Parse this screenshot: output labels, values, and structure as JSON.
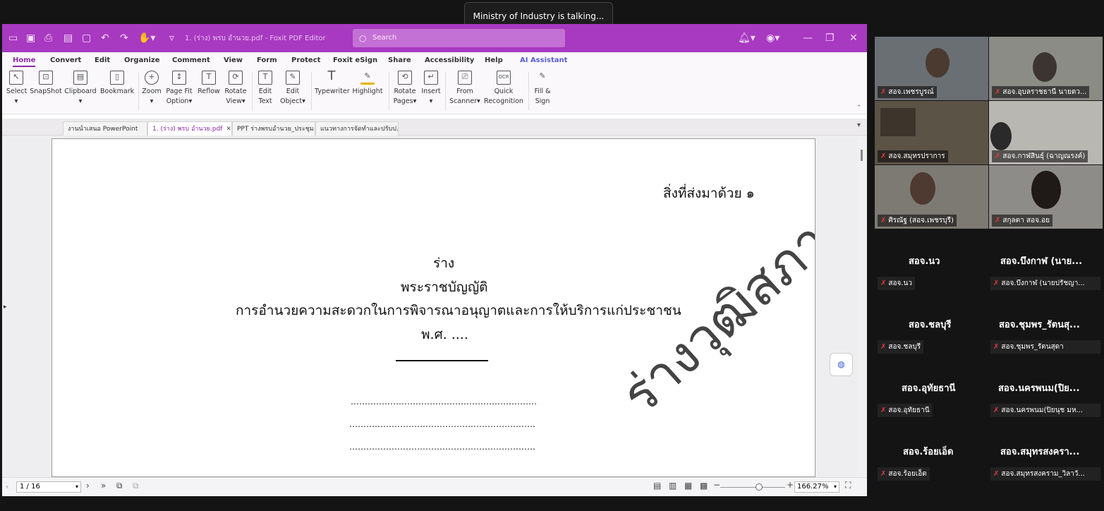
{
  "meeting": {
    "talking_banner": "Ministry of Industry is talking..."
  },
  "app": {
    "title": "1. (ร่าง) พรบ อำนวย.pdf - Foxit PDF Editor",
    "search_placeholder": "Search",
    "menu": [
      "Home",
      "Convert",
      "Edit",
      "Organize",
      "Comment",
      "View",
      "Form",
      "Protect",
      "Foxit eSign",
      "Share",
      "Accessibility",
      "Help",
      "AI Assistant"
    ],
    "ribbon": [
      {
        "l1": "Select",
        "l2": "",
        "icon": "select-icon"
      },
      {
        "l1": "SnapShot",
        "l2": "",
        "icon": "snapshot-icon"
      },
      {
        "l1": "Clipboard",
        "l2": "",
        "icon": "clipboard-icon"
      },
      {
        "l1": "Bookmark",
        "l2": "",
        "icon": "bookmark-icon"
      },
      {
        "l1": "Zoom",
        "l2": "",
        "icon": "zoom-icon"
      },
      {
        "l1": "Page Fit",
        "l2": "Option",
        "icon": "page-fit-icon"
      },
      {
        "l1": "Reflow",
        "l2": "",
        "icon": "reflow-icon"
      },
      {
        "l1": "Rotate",
        "l2": "View",
        "icon": "rotate-view-icon"
      },
      {
        "l1": "Edit",
        "l2": "Text",
        "icon": "edit-text-icon"
      },
      {
        "l1": "Edit",
        "l2": "Object",
        "icon": "edit-object-icon"
      },
      {
        "l1": "Typewriter",
        "l2": "",
        "icon": "typewriter-icon"
      },
      {
        "l1": "Highlight",
        "l2": "",
        "icon": "highlight-icon"
      },
      {
        "l1": "Rotate",
        "l2": "Pages",
        "icon": "rotate-pages-icon"
      },
      {
        "l1": "Insert",
        "l2": "",
        "icon": "insert-icon"
      },
      {
        "l1": "From",
        "l2": "Scanner",
        "icon": "scanner-icon"
      },
      {
        "l1": "Quick",
        "l2": "Recognition",
        "icon": "ocr-icon"
      },
      {
        "l1": "Fill &",
        "l2": "Sign",
        "icon": "fill-sign-icon"
      }
    ],
    "doc_tabs": [
      "งานนำเสนอ PowerPoint",
      "1. (ร่าง) พรบ อำนวย.pdf",
      "PPT ร่างพรบอำนวย_ประชุม...",
      "แนวทางการจัดทำและปรับป..."
    ],
    "document": {
      "attachment": "สิ่งที่ส่งมาด้วย ๑",
      "draft": "ร่าง",
      "act": "พระราชบัญญัติ",
      "subject": "การอำนวยความสะดวกในการพิจารณาอนุญาตและการให้บริการแก่ประชาชน",
      "year": "พ.ศ. ....",
      "dots": "…………………………………………………………",
      "watermark": "ร่างวุฒิสภา"
    },
    "status": {
      "page": "1 / 16",
      "zoom": "166.27%"
    }
  },
  "participants": [
    {
      "name": "สอจ.เพชรบูรณ์",
      "video": true,
      "bg": "#6a6f74"
    },
    {
      "name": "สอจ.อุบลราชธานี นายดว...",
      "video": true,
      "bg": "#8b8c86"
    },
    {
      "name": "สอจ.สมุทรปราการ",
      "video": true,
      "bg": "#5c5347"
    },
    {
      "name": "สอจ.กาฬสินธุ์ (ฉาญณรงค์)",
      "video": true,
      "bg": "#b9b7b2"
    },
    {
      "name": "ศิรณัฐ (สอจ.เพชรบุรี)",
      "video": true,
      "bg": "#7d7a74"
    },
    {
      "name": "สกุลตา สอจ.อย",
      "video": true,
      "bg": "#8e8c88"
    },
    {
      "big": "สอจ.นว",
      "name": "สอจ.นว",
      "video": false
    },
    {
      "big": "สอจ.บึงกาฬ (นาย...",
      "name": "สอจ.บึงกาฬ (นายปรัชญา...",
      "video": false
    },
    {
      "big": "สอจ.ชลบุรี",
      "name": "สอจ.ชลบุรี",
      "video": false
    },
    {
      "big": "สอจ.ชุมพร_รัตนสุ...",
      "name": "สอจ.ชุมพร_รัตนสุดา",
      "video": false
    },
    {
      "big": "สอจ.อุทัยธานี",
      "name": "สอจ.อุทัยธานี",
      "video": false
    },
    {
      "big": "สอจ.นครพนม(ปิย...",
      "name": "สอจ.นครพนม(ปิยนุช มห...",
      "video": false
    },
    {
      "big": "สอจ.ร้อยเอ็ด",
      "name": "สอจ.ร้อยเอ็ด",
      "video": false
    },
    {
      "big": "สอจ.สมุทรสงครา...",
      "name": "สอจ.สมุทรสงคราม_วิลาวั...",
      "video": false
    }
  ],
  "colors": {
    "accent": "#a839c1",
    "mic_muted": "#e03b3b"
  }
}
